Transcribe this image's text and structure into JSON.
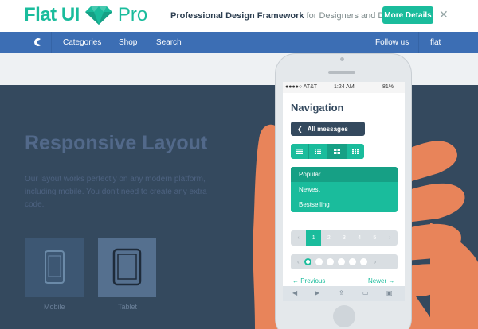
{
  "banner": {
    "logo_flat": "Flat UI",
    "logo_pro": "Pro",
    "tagline_bold": "Professional Design Framework",
    "tagline_rest": " for Designers and Developers",
    "more_details": "More Details",
    "close": "✕"
  },
  "nav": {
    "items": [
      "Categories",
      "Shop",
      "Search"
    ],
    "right": [
      "Follow us",
      "flat"
    ]
  },
  "hero": {
    "title": "Responsive Layout",
    "text": "Our layout works perfectly on any modern platform, including mobile. You don't need to create any extra code."
  },
  "devices": [
    {
      "label": "Mobile",
      "icon": "smartphone-icon"
    },
    {
      "label": "Tablet",
      "icon": "tablet-icon"
    }
  ],
  "phone": {
    "status": {
      "carrier": "●●●●○ AT&T",
      "time": "1:24 AM",
      "battery": "81%"
    },
    "heading": "Navigation",
    "back_label": "All messages",
    "view_modes": [
      "list-icon",
      "list-detail-icon",
      "grid-large-icon",
      "grid-small-icon"
    ],
    "menu": [
      "Popular",
      "Newest",
      "Bestselling"
    ],
    "pages": [
      "‹",
      "1",
      "2",
      "3",
      "4",
      "5",
      "›"
    ],
    "prev": "← Previous",
    "next": "Newer →"
  },
  "colors": {
    "brand": "#1abc9c",
    "nav_blue": "#3c6eb4",
    "background": "#34495e"
  }
}
